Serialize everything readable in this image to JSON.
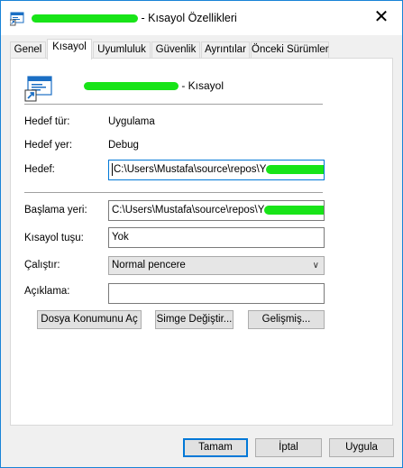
{
  "window": {
    "title_suffix": "- Kısayol Özellikleri",
    "close_label": "✕"
  },
  "tabs": [
    {
      "label": "Genel",
      "active": false
    },
    {
      "label": "Kısayol",
      "active": true
    },
    {
      "label": "Uyumluluk",
      "active": false
    },
    {
      "label": "Güvenlik",
      "active": false
    },
    {
      "label": "Ayrıntılar",
      "active": false
    },
    {
      "label": "Önceki Sürümler",
      "active": false
    }
  ],
  "shortcut": {
    "name_suffix": "- Kısayol",
    "target_type_label": "Hedef tür:",
    "target_type_value": "Uygulama",
    "target_location_label": "Hedef yer:",
    "target_location_value": "Debug",
    "target_label": "Hedef:",
    "target_value": "C:\\Users\\Mustafa\\source\\repos\\Y",
    "start_in_label": "Başlama yeri:",
    "start_in_value": "C:\\Users\\Mustafa\\source\\repos\\Y",
    "shortcut_key_label": "Kısayol tuşu:",
    "shortcut_key_value": "Yok",
    "run_label": "Çalıştır:",
    "run_value": "Normal pencere",
    "comment_label": "Açıklama:",
    "comment_value": ""
  },
  "actions": {
    "open_location": "Dosya Konumunu Aç",
    "change_icon": "Simge Değiştir...",
    "advanced": "Gelişmiş..."
  },
  "footer": {
    "ok": "Tamam",
    "cancel": "İptal",
    "apply": "Uygula"
  },
  "icons": {
    "app_icon": "shortcut-app-icon",
    "close_icon": "close-icon",
    "dropdown_icon": "chevron-down-icon"
  },
  "colors": {
    "accent": "#0078d7",
    "redaction": "#18e418"
  }
}
